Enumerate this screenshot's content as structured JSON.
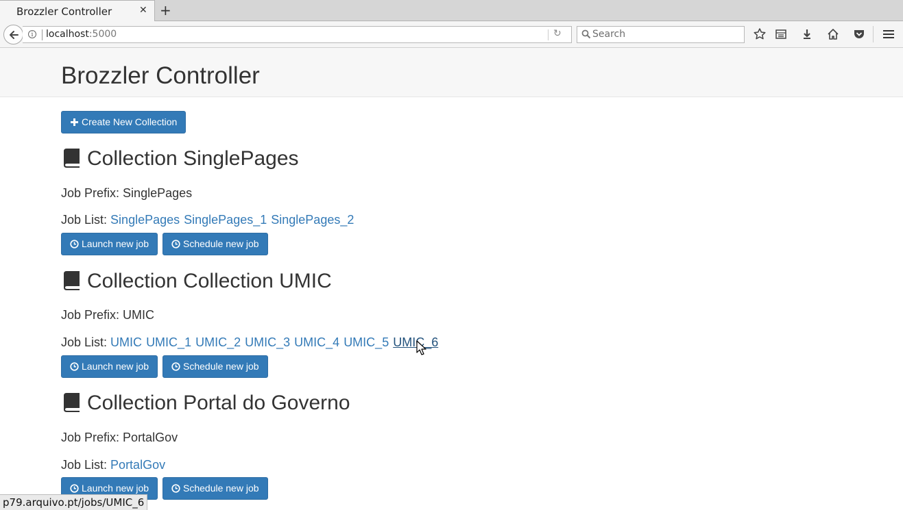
{
  "browser": {
    "tab_title": "Brozzler Controller",
    "url_host": "localhost",
    "url_port": ":5000",
    "search_placeholder": "Search",
    "status_url": "p79.arquivo.pt/jobs/UMIC_6"
  },
  "page": {
    "title": "Brozzler Controller",
    "create_button": "Create New Collection"
  },
  "labels": {
    "job_prefix": "Job Prefix: ",
    "job_list": "Job List: ",
    "launch": "Launch new job",
    "schedule": "Schedule new job"
  },
  "collections": [
    {
      "title": "Collection SinglePages",
      "prefix": "SinglePages",
      "jobs": [
        "SinglePages",
        "SinglePages_1",
        "SinglePages_2"
      ]
    },
    {
      "title": "Collection Collection UMIC",
      "prefix": "UMIC",
      "jobs": [
        "UMIC",
        "UMIC_1",
        "UMIC_2",
        "UMIC_3",
        "UMIC_4",
        "UMIC_5",
        "UMIC_6"
      ]
    },
    {
      "title": "Collection Portal do Governo",
      "prefix": "PortalGov",
      "jobs": [
        "PortalGov"
      ]
    }
  ],
  "icons": {
    "collection": "book-icon",
    "create": "plus-icon",
    "launch": "clock-icon",
    "schedule": "clock-icon"
  },
  "colors": {
    "primary": "#337ab7",
    "link": "#337ab7",
    "link_hover": "#23527c"
  }
}
